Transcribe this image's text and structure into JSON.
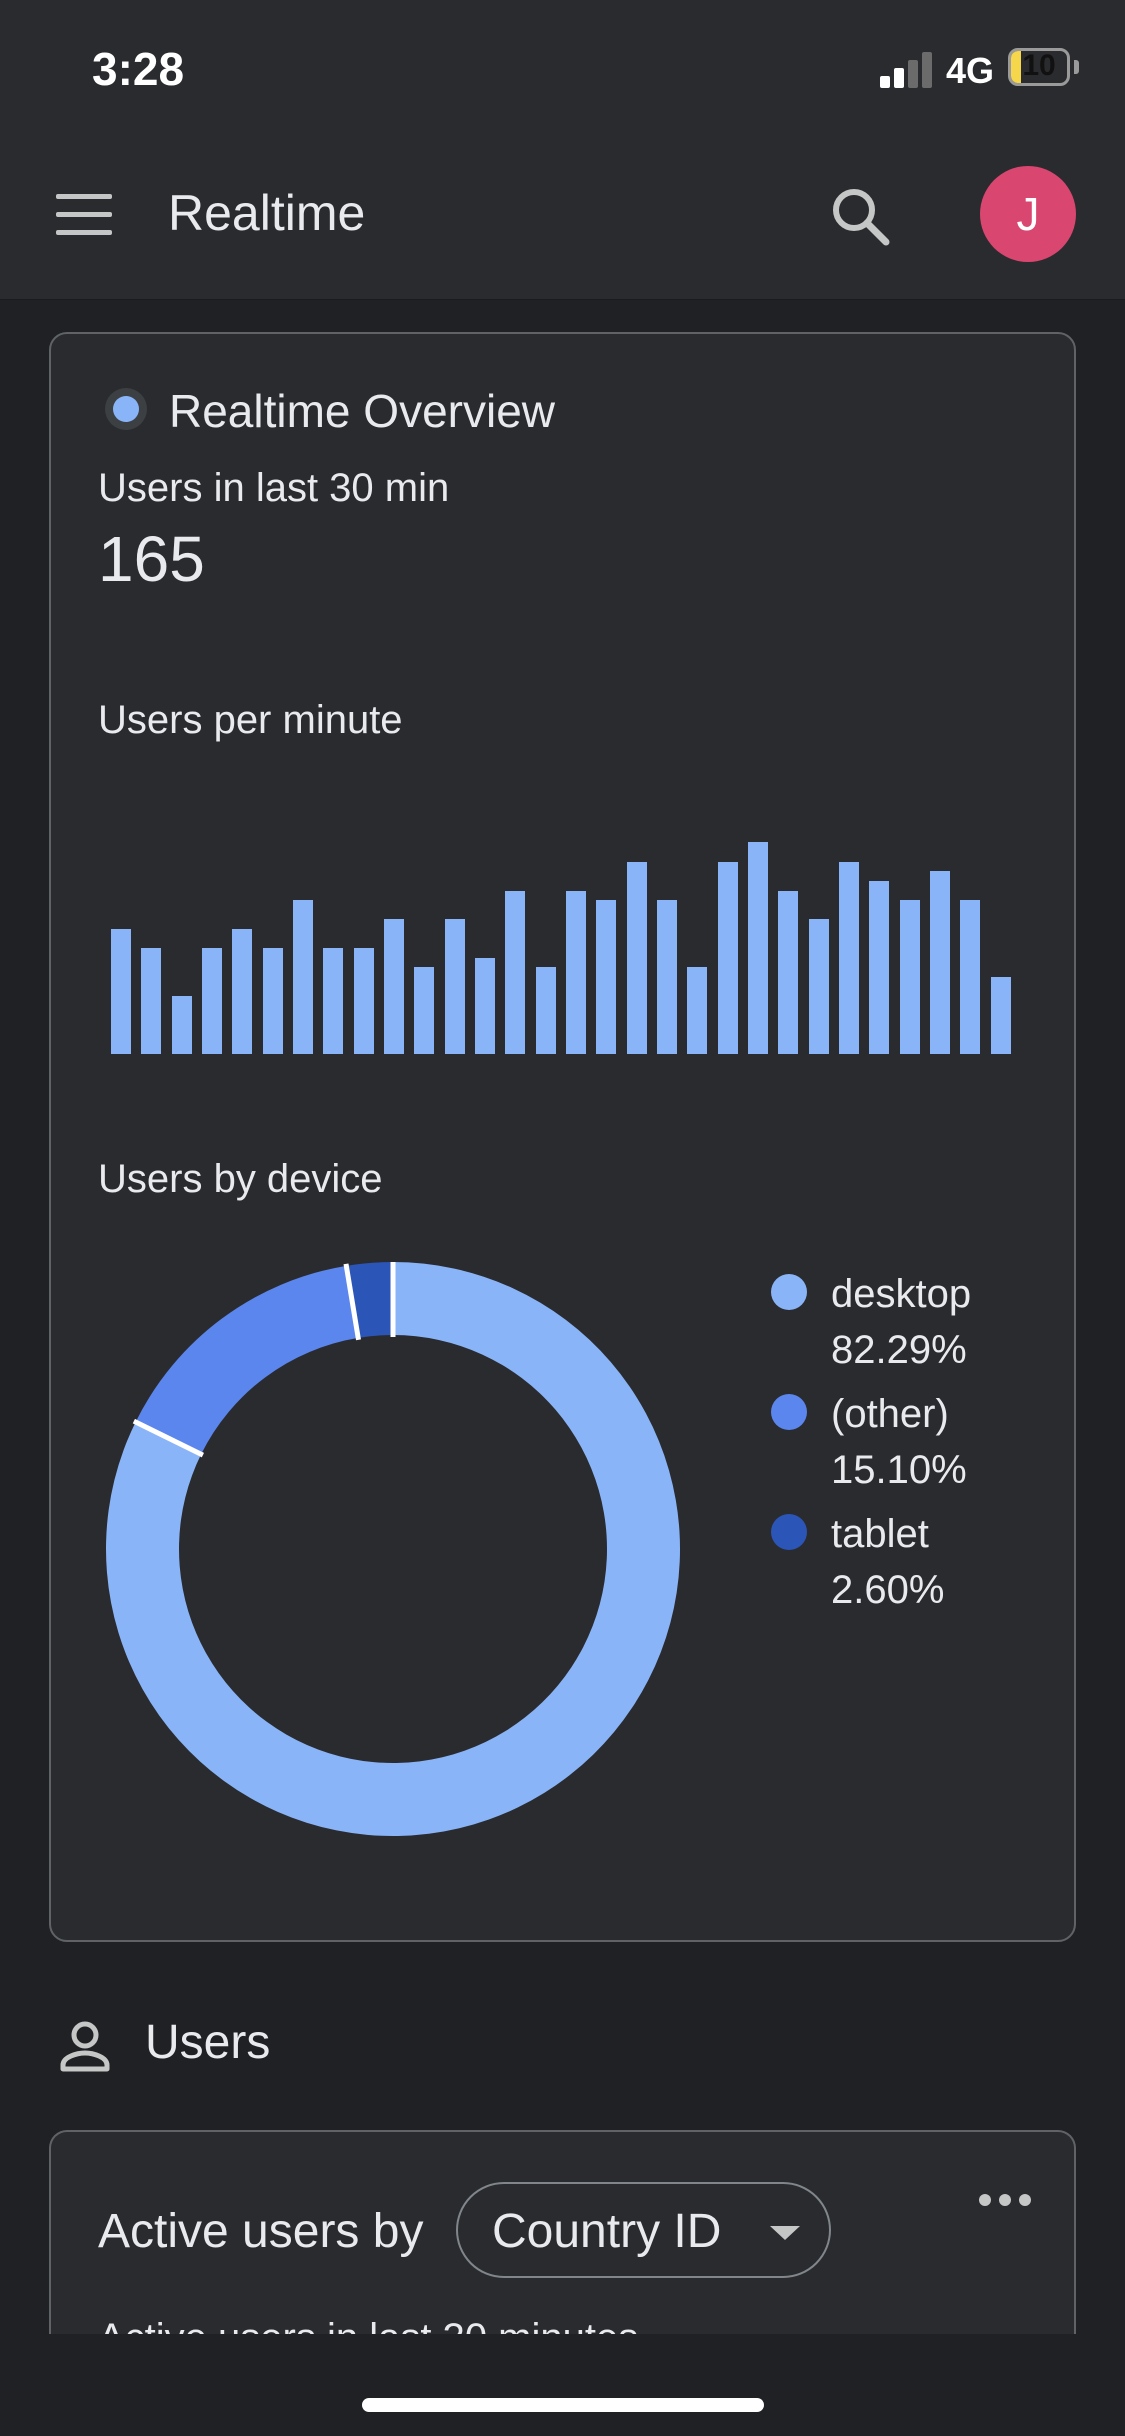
{
  "status_bar": {
    "time": "3:28",
    "network": "4G",
    "battery_level": "10",
    "signal_bars_active": 2,
    "signal_bars_total": 4
  },
  "app_bar": {
    "title": "Realtime",
    "menu_icon": "hamburger-menu-icon",
    "search_icon": "search-icon",
    "avatar_initial": "J",
    "avatar_color": "#d9466f"
  },
  "overview": {
    "title": "Realtime Overview",
    "users_label": "Users in last 30 min",
    "users_value": "165",
    "per_minute_label": "Users per minute",
    "by_device_label": "Users by device"
  },
  "users_section": {
    "title": "Users",
    "icon": "person-icon"
  },
  "active_users": {
    "title": "Active users by",
    "dimension": "Country ID",
    "subtitle": "Active users in last 30 minutes",
    "more_icon": "more-horizontal-icon"
  },
  "colors": {
    "accent": "#8ab4f8",
    "desktop": "#8ab4f8",
    "other": "#5b86ee",
    "tablet": "#2b56b8",
    "background": "#202124",
    "card": "#2a2b2e"
  },
  "chart_data": [
    {
      "type": "bar",
      "title": "Users per minute",
      "xlabel": "",
      "ylabel": "",
      "series": [
        {
          "values": [
            13,
            11,
            6,
            11,
            13,
            11,
            16,
            11,
            11,
            14,
            9,
            14,
            10,
            17,
            9,
            17,
            16,
            20,
            16,
            9,
            20,
            22,
            17,
            14,
            20,
            18,
            16,
            19,
            16,
            8
          ]
        }
      ],
      "ylim": [
        0,
        22
      ],
      "grid": false
    },
    {
      "type": "pie",
      "title": "Users by device",
      "categories": [
        "desktop",
        "(other)",
        "tablet"
      ],
      "values": [
        82.29,
        15.1,
        2.6
      ],
      "value_labels": [
        "82.29%",
        "15.10%",
        "2.60%"
      ],
      "legend_placement": "right"
    }
  ]
}
